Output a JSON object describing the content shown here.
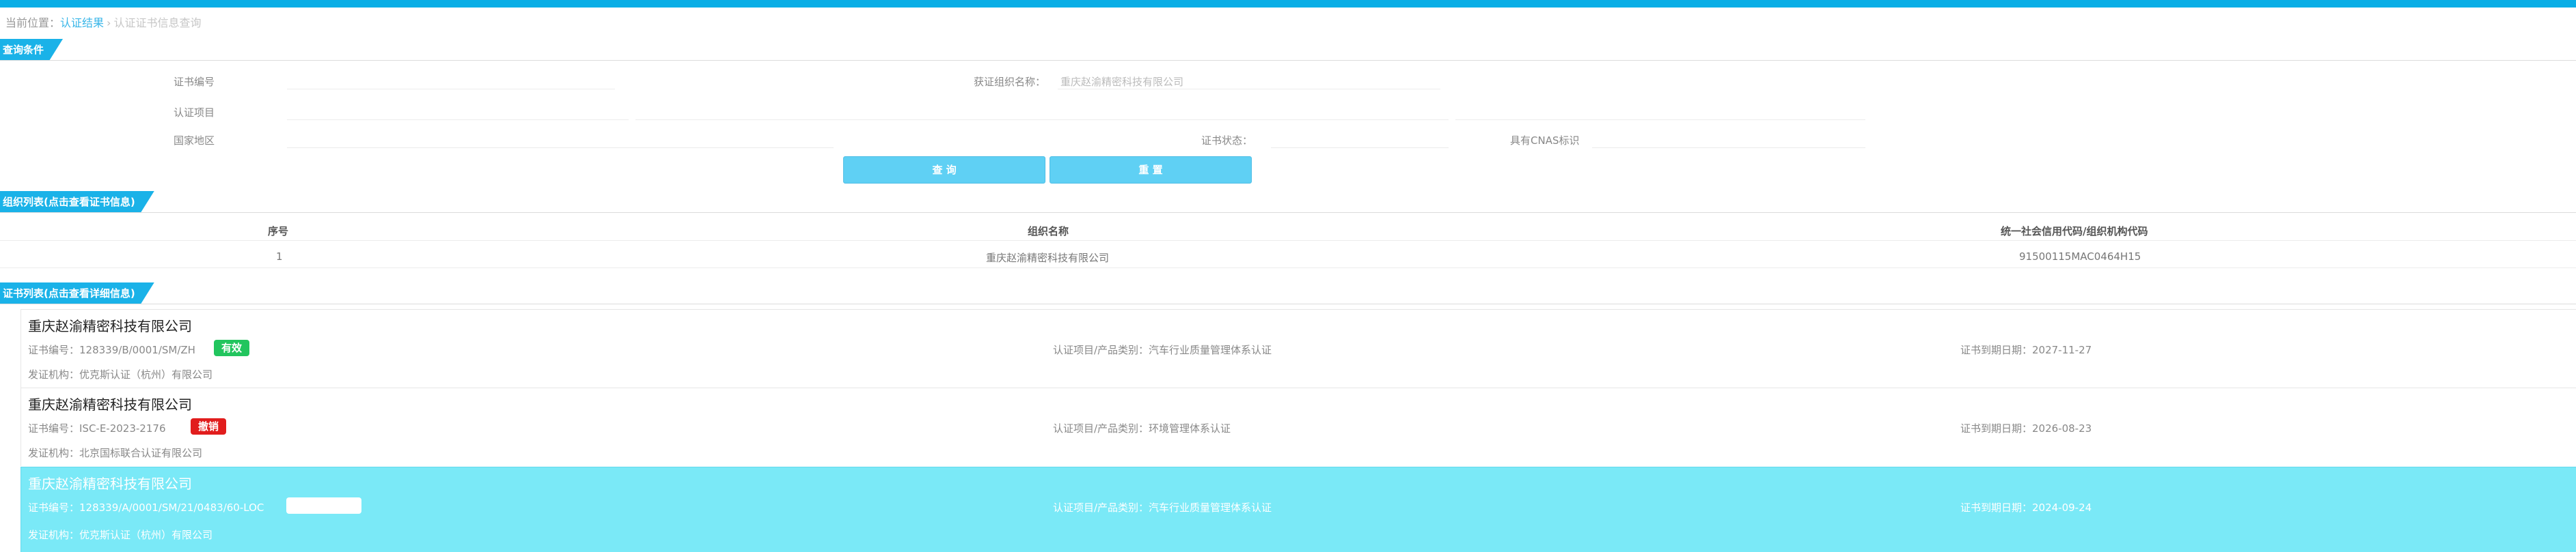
{
  "breadcrumb": {
    "prefix": "当前位置：",
    "link": "认证结果",
    "separator": "›",
    "current": "认证证书信息查询"
  },
  "query": {
    "section_title": "查询条件",
    "cert_no_label": "证书编号",
    "cert_no_value": "",
    "org_name_label": "获证组织名称：",
    "org_name_value": "重庆赵渝精密科技有限公司",
    "project_label": "认证项目",
    "project_value": "",
    "region_label": "国家地区",
    "region_value": "",
    "status_label": "证书状态：",
    "status_value": "",
    "cnas_label": "具有CNAS标识",
    "cnas_value": "",
    "search_button": "查 询",
    "reset_button": "重 置"
  },
  "org_list": {
    "section_title": "组织列表(点击查看证书信息)",
    "columns": [
      "序号",
      "组织名称",
      "统一社会信用代码/组织机构代码"
    ],
    "rows": [
      [
        "1",
        "重庆赵渝精密科技有限公司",
        "91500115MAC0464H15"
      ]
    ]
  },
  "cert_list": {
    "section_title": "证书列表(点击查看详细信息)",
    "items": [
      {
        "org": "重庆赵渝精密科技有限公司",
        "cert_no": "证书编号：128339/B/0001/SM/ZH",
        "status": "有效",
        "status_color": "#22c55e",
        "project": "认证项目/产品类别：汽车行业质量管理体系认证",
        "expiry": "证书到期日期：2027-11-27",
        "issuer": "发证机构：优克斯认证（杭州）有限公司"
      },
      {
        "org": "重庆赵渝精密科技有限公司",
        "cert_no": "证书编号：ISC-E-2023-2176",
        "status": "撤销",
        "status_color": "#e11d1d",
        "project": "认证项目/产品类别：环境管理体系认证",
        "expiry": "证书到期日期：2026-08-23",
        "issuer": "发证机构：北京国标联合认证有限公司"
      },
      {
        "org": "重庆赵渝精密科技有限公司",
        "cert_no": "证书编号：128339/A/0001/SM/21/0483/60-LOC",
        "status": "",
        "status_color": "#ffffff",
        "project": "认证项目/产品类别：汽车行业质量管理体系认证",
        "expiry": "证书到期日期：2024-09-24",
        "issuer": "发证机构：优克斯认证（杭州）有限公司"
      }
    ]
  }
}
